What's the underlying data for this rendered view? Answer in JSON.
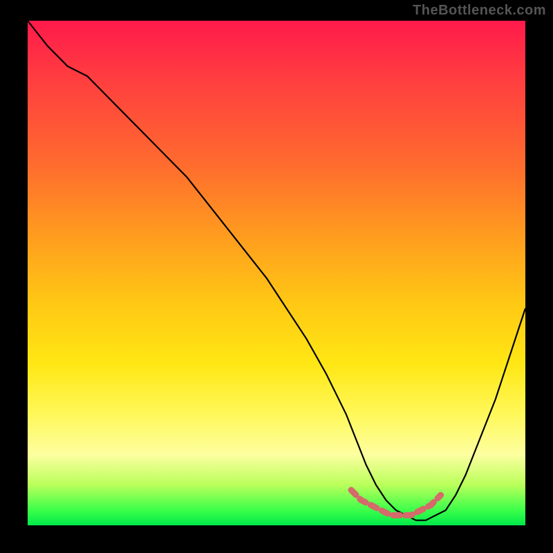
{
  "watermark": "TheBottleneck.com",
  "chart_data": {
    "type": "line",
    "title": "",
    "xlabel": "",
    "ylabel": "",
    "xlim": [
      0,
      100
    ],
    "ylim": [
      0,
      100
    ],
    "grid": false,
    "series": [
      {
        "name": "curve",
        "x": [
          0,
          4,
          8,
          12,
          16,
          20,
          24,
          28,
          32,
          36,
          40,
          44,
          48,
          52,
          56,
          60,
          62,
          64,
          66,
          68,
          70,
          72,
          74,
          76,
          78,
          80,
          82,
          84,
          86,
          88,
          90,
          92,
          94,
          96,
          98,
          100
        ],
        "y": [
          100,
          95,
          91,
          89,
          85,
          81,
          77,
          73,
          69,
          64,
          59,
          54,
          49,
          43,
          37,
          30,
          26,
          22,
          17,
          12,
          8,
          5,
          3,
          2,
          1,
          1,
          2,
          3,
          6,
          10,
          15,
          20,
          25,
          31,
          37,
          43
        ]
      },
      {
        "name": "marker-band",
        "x": [
          65,
          67,
          69,
          71,
          73,
          75,
          77,
          79,
          81,
          83
        ],
        "y": [
          7,
          5,
          4,
          3,
          2,
          2,
          2,
          3,
          4,
          6
        ]
      }
    ],
    "colors": {
      "curve": "#000000",
      "marker": "#d46a6a"
    }
  }
}
